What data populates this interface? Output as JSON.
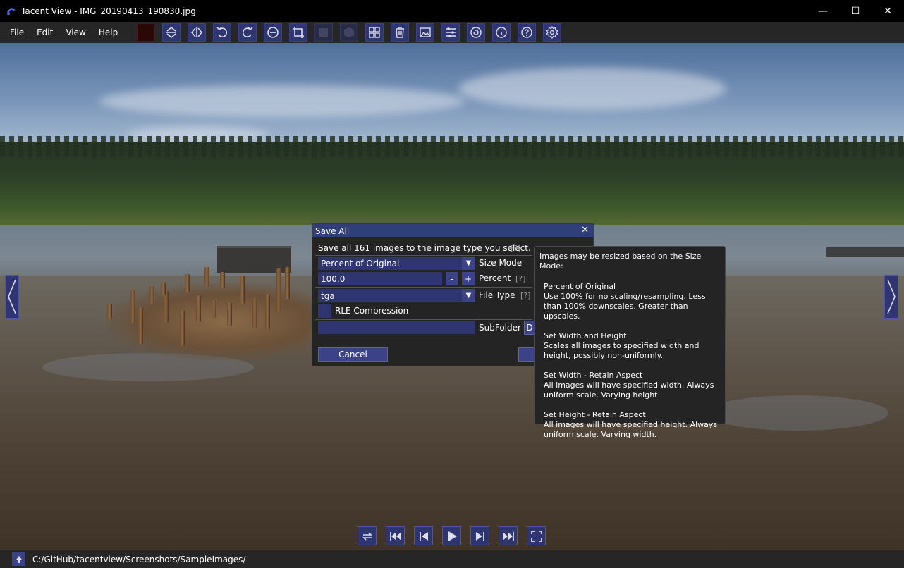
{
  "window": {
    "title": "Tacent View - IMG_20190413_190830.jpg",
    "minimize": "—",
    "maximize": "☐",
    "close": "✕"
  },
  "menu": {
    "items": [
      "File",
      "Edit",
      "View",
      "Help"
    ]
  },
  "toolbar": {
    "color_swatch": "#2a0808",
    "icons": [
      "flip-vertical-icon",
      "flip-horizontal-icon",
      "rotate-ccw-icon",
      "rotate-cw-icon",
      "minus-circle-icon",
      "crop-icon",
      "square-icon",
      "cube-icon",
      "grid-icon",
      "trash-icon",
      "image-icon",
      "sliders-icon",
      "refresh-icon",
      "info-icon",
      "help-icon",
      "gear-icon"
    ]
  },
  "dialog": {
    "title": "Save All",
    "close": "✕",
    "description": "Save all 161 images to the image type you select.",
    "help_tag": "[?]",
    "size_mode": {
      "value": "Percent of Original",
      "label": "Size Mode"
    },
    "percent": {
      "value": "100.0",
      "minus": "-",
      "plus": "+",
      "label": "Percent",
      "help_tag": "[?]"
    },
    "file_type": {
      "value": "tga",
      "label": "File Type",
      "help_tag": "[?]"
    },
    "rle": {
      "label": "RLE Compression",
      "checked": false
    },
    "subfolder": {
      "value": "",
      "label": "SubFolder",
      "default_button": "D"
    },
    "cancel": "Cancel"
  },
  "tooltip": {
    "heading": "Images may be resized based on the Size Mode:",
    "sections": [
      {
        "title": "Percent of Original",
        "lines": [
          "Use 100% for no scaling/resampling. Less",
          "than 100% downscales. Greater than upscales."
        ]
      },
      {
        "title": "Set Width and Height",
        "lines": [
          "Scales all images to specified width and",
          "height, possibly non-uniformly."
        ]
      },
      {
        "title": "Set Width - Retain Aspect",
        "lines": [
          "All images will have specified width. Always",
          "uniform scale. Varying height."
        ]
      },
      {
        "title": "Set Height - Retain Aspect",
        "lines": [
          "All images will have specified height. Always",
          "uniform scale. Varying width."
        ]
      }
    ]
  },
  "playback": {
    "icons": [
      "loop-icon",
      "skip-back-icon",
      "prev-icon",
      "play-icon",
      "next-icon",
      "skip-forward-icon",
      "fullscreen-icon"
    ]
  },
  "status": {
    "path": "C:/GitHub/tacentview/Screenshots/SampleImages/"
  }
}
